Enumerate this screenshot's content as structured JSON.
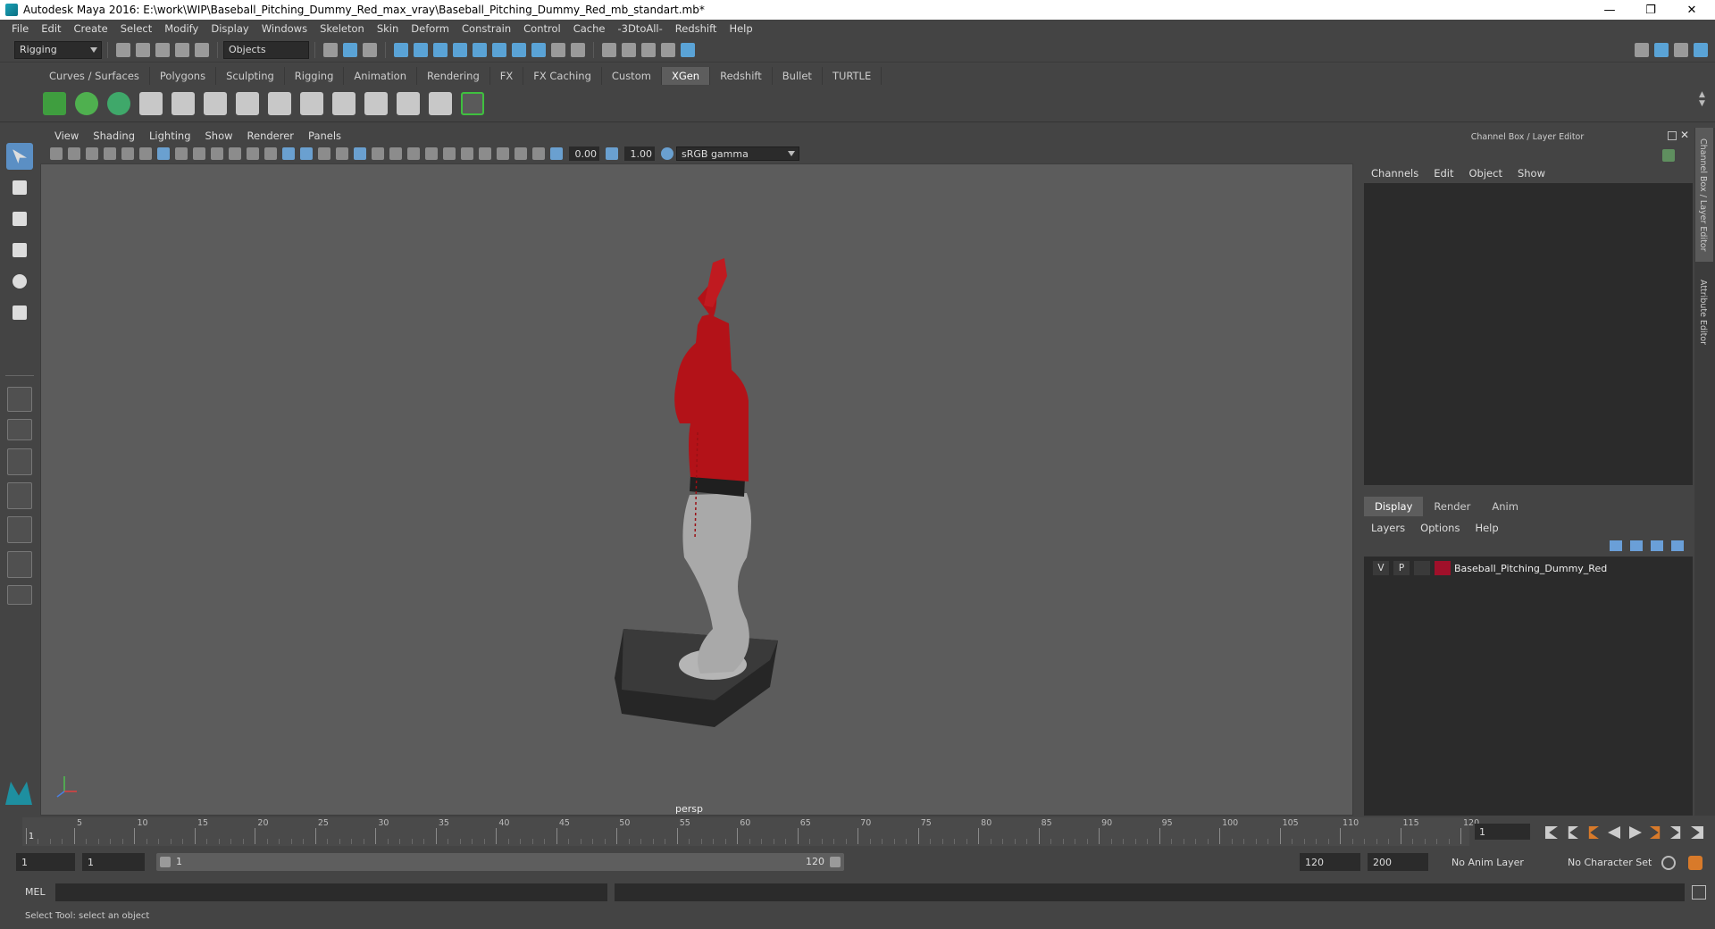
{
  "window": {
    "title": "Autodesk Maya 2016: E:\\work\\WIP\\Baseball_Pitching_Dummy_Red_max_vray\\Baseball_Pitching_Dummy_Red_mb_standart.mb*"
  },
  "menubar": [
    "File",
    "Edit",
    "Create",
    "Select",
    "Modify",
    "Display",
    "Windows",
    "Skeleton",
    "Skin",
    "Deform",
    "Constrain",
    "Control",
    "Cache",
    "-3DtoAll-",
    "Redshift",
    "Help"
  ],
  "statusline": {
    "mode": "Rigging",
    "selection_mask": "Objects"
  },
  "shelf_tabs": [
    "Curves / Surfaces",
    "Polygons",
    "Sculpting",
    "Rigging",
    "Animation",
    "Rendering",
    "FX",
    "FX Caching",
    "Custom",
    "XGen",
    "Redshift",
    "Bullet",
    "TURTLE"
  ],
  "shelf_active": "XGen",
  "viewport": {
    "menu": [
      "View",
      "Shading",
      "Lighting",
      "Show",
      "Renderer",
      "Panels"
    ],
    "exposure": "0.00",
    "gamma": "1.00",
    "color_space": "sRGB gamma",
    "camera": "persp"
  },
  "channel_box": {
    "title": "Channel Box / Layer Editor",
    "menu": [
      "Channels",
      "Edit",
      "Object",
      "Show"
    ]
  },
  "layer_editor": {
    "tabs": [
      "Display",
      "Render",
      "Anim"
    ],
    "active_tab": "Display",
    "menu": [
      "Layers",
      "Options",
      "Help"
    ],
    "layers": [
      {
        "v": "V",
        "p": "P",
        "color": "#a0102a",
        "name": "Baseball_Pitching_Dummy_Red"
      }
    ]
  },
  "side_tabs": [
    "Channel Box / Layer Editor",
    "Attribute Editor"
  ],
  "timeline": {
    "ticks": [
      "1",
      "5",
      "10",
      "15",
      "20",
      "25",
      "30",
      "35",
      "40",
      "45",
      "50",
      "55",
      "60",
      "65",
      "70",
      "75",
      "80",
      "85",
      "90",
      "95",
      "100",
      "105",
      "110",
      "115",
      "120"
    ],
    "current_frame": "1"
  },
  "range": {
    "start": "1",
    "playback_start": "1",
    "slider_start": "1",
    "slider_end": "120",
    "playback_end": "120",
    "end": "200",
    "anim_layer": "No Anim Layer",
    "character_set": "No Character Set"
  },
  "command_line": {
    "label": "MEL"
  },
  "status_message": "Select Tool: select an object",
  "colors": {
    "dummy_red": "#b31218",
    "pants_gray": "#a8a8a8",
    "base_black": "#2a2a2a",
    "accent_blue": "#5b8fc4"
  }
}
